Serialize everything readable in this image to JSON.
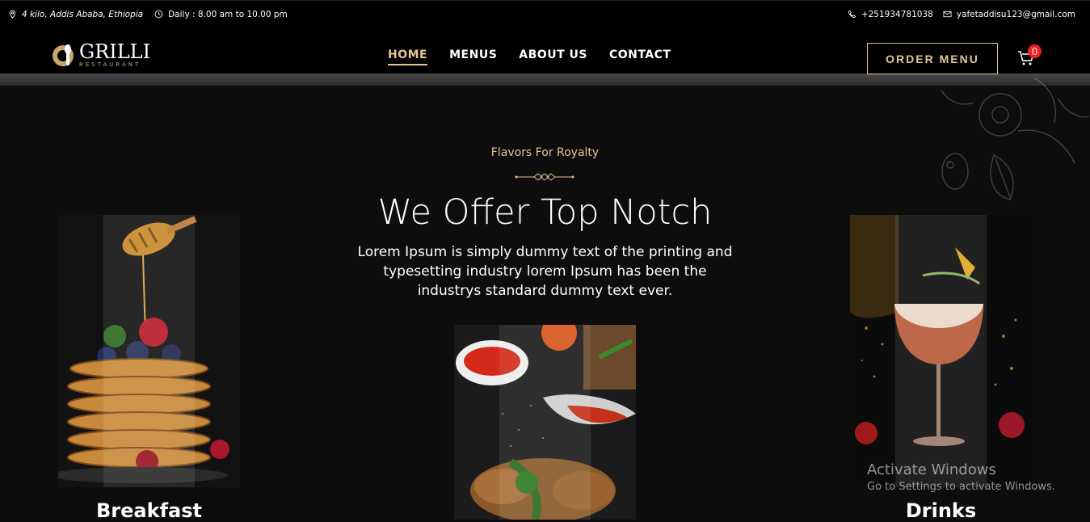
{
  "topbar": {
    "address": "4 kilo, Addis Ababa, Ethiopia",
    "hours": "Daily : 8.00 am to 10.00 pm",
    "phone": "+251934781038",
    "email": "yafetaddisu123@gmail.com"
  },
  "brand": {
    "name": "GRILLI",
    "tagline": "RESTAURANT"
  },
  "nav": [
    {
      "label": "HOME",
      "active": true
    },
    {
      "label": "MENUS",
      "active": false
    },
    {
      "label": "ABOUT US",
      "active": false
    },
    {
      "label": "CONTACT",
      "active": false
    }
  ],
  "order_button": "ORDER MENU",
  "cart_count": "0",
  "hero": {
    "subtitle": "Flavors For Royalty",
    "title": "We Offer Top Notch",
    "description": "Lorem Ipsum is simply dummy text of the printing and typesetting industry lorem Ipsum has been the industrys standard dummy text ever."
  },
  "cards": [
    {
      "label": "Breakfast",
      "image": "pancakes-with-berries-and-honey"
    },
    {
      "label": "",
      "image": "grilled-meat-with-sauces"
    },
    {
      "label": "Drinks",
      "image": "cocktail-glass"
    }
  ],
  "watermark": {
    "line1": "Activate Windows",
    "line2": "Go to Settings to activate Windows."
  },
  "colors": {
    "accent": "#e4c590",
    "background": "#0e0d0d",
    "badge": "#e22222"
  }
}
